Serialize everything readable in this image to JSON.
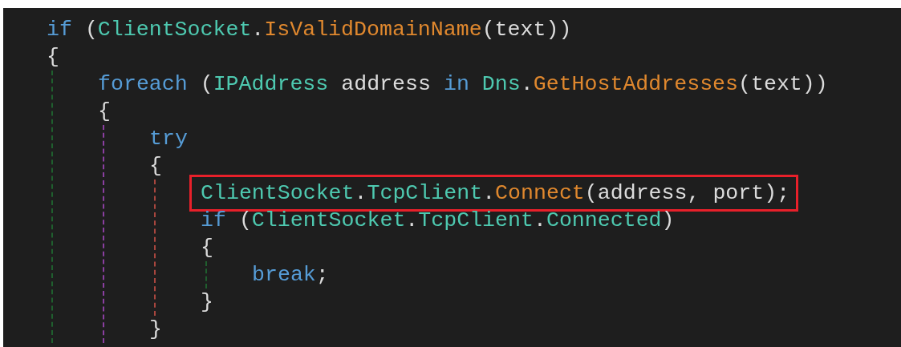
{
  "code_lines": [
    {
      "highlighted": false,
      "tokens": [
        {
          "kind": "keyword",
          "text": "if"
        },
        {
          "kind": "plain",
          "text": " ("
        },
        {
          "kind": "type",
          "text": "ClientSocket"
        },
        {
          "kind": "plain",
          "text": "."
        },
        {
          "kind": "method",
          "text": "IsValidDomainName"
        },
        {
          "kind": "plain",
          "text": "(text))"
        }
      ]
    },
    {
      "highlighted": false,
      "tokens": [
        {
          "kind": "plain",
          "text": "{"
        }
      ],
      "children": [
        {
          "highlighted": false,
          "tokens": [
            {
              "kind": "keyword",
              "text": "foreach"
            },
            {
              "kind": "plain",
              "text": " ("
            },
            {
              "kind": "type",
              "text": "IPAddress"
            },
            {
              "kind": "plain",
              "text": " address "
            },
            {
              "kind": "keyword",
              "text": "in "
            },
            {
              "kind": "type",
              "text": "Dns"
            },
            {
              "kind": "plain",
              "text": "."
            },
            {
              "kind": "method",
              "text": "GetHostAddresses"
            },
            {
              "kind": "plain",
              "text": "(text))"
            }
          ]
        },
        {
          "highlighted": false,
          "tokens": [
            {
              "kind": "plain",
              "text": "{"
            }
          ],
          "children": [
            {
              "highlighted": false,
              "tokens": [
                {
                  "kind": "keyword",
                  "text": "try"
                }
              ]
            },
            {
              "highlighted": false,
              "tokens": [
                {
                  "kind": "plain",
                  "text": "{"
                }
              ],
              "children": [
                {
                  "highlighted": true,
                  "tokens": [
                    {
                      "kind": "type",
                      "text": "ClientSocket"
                    },
                    {
                      "kind": "plain",
                      "text": "."
                    },
                    {
                      "kind": "type",
                      "text": "TcpClient"
                    },
                    {
                      "kind": "plain",
                      "text": "."
                    },
                    {
                      "kind": "method",
                      "text": "Connect"
                    },
                    {
                      "kind": "plain",
                      "text": "(address, port);"
                    }
                  ]
                },
                {
                  "highlighted": false,
                  "tokens": [
                    {
                      "kind": "keyword",
                      "text": "if"
                    },
                    {
                      "kind": "plain",
                      "text": " ("
                    },
                    {
                      "kind": "type",
                      "text": "ClientSocket"
                    },
                    {
                      "kind": "plain",
                      "text": "."
                    },
                    {
                      "kind": "type",
                      "text": "TcpClient"
                    },
                    {
                      "kind": "plain",
                      "text": "."
                    },
                    {
                      "kind": "type",
                      "text": "Connected"
                    },
                    {
                      "kind": "plain",
                      "text": ")"
                    }
                  ]
                },
                {
                  "highlighted": false,
                  "tokens": [
                    {
                      "kind": "plain",
                      "text": "{"
                    }
                  ],
                  "children": [
                    {
                      "highlighted": false,
                      "tokens": [
                        {
                          "kind": "keyword",
                          "text": "break"
                        },
                        {
                          "kind": "plain",
                          "text": ";"
                        }
                      ]
                    }
                  ]
                },
                {
                  "highlighted": false,
                  "tokens": [
                    {
                      "kind": "plain",
                      "text": "}"
                    }
                  ]
                }
              ]
            },
            {
              "highlighted": false,
              "tokens": [
                {
                  "kind": "plain",
                  "text": "}"
                }
              ]
            }
          ]
        }
      ]
    }
  ]
}
